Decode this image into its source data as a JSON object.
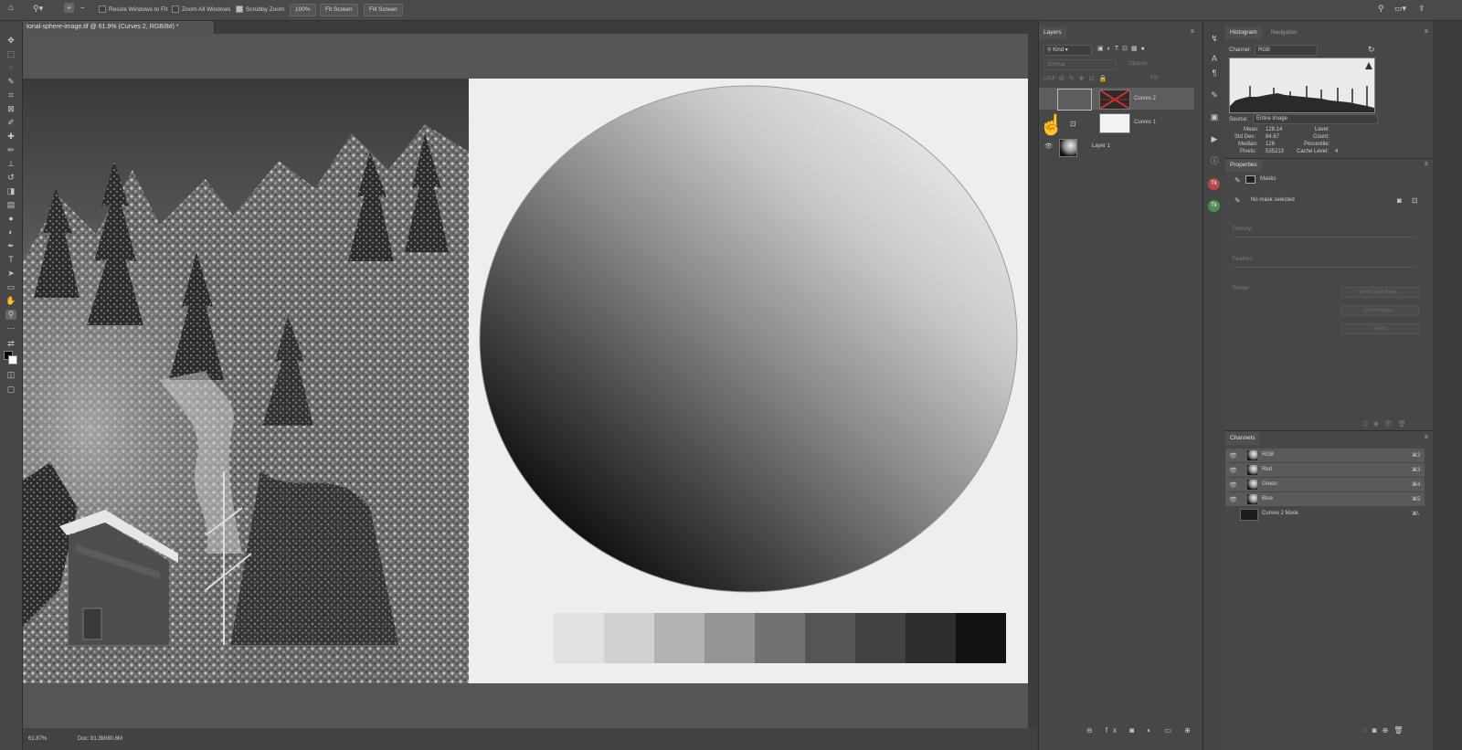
{
  "options_bar": {
    "resize_windows": "Resize Windows to Fit",
    "zoom_all": "Zoom All Windows",
    "scrubby_zoom": "Scrubby Zoom",
    "btn_100": "100%",
    "btn_fit": "Fit Screen",
    "btn_fill": "Fill Screen"
  },
  "document": {
    "tab_title": "tonal-sphere-image.tif @ 61.9% (Curves 2, RGB/8#) *",
    "zoom": "61.87%",
    "doc_info": "Doc: 81.3M/80.6M"
  },
  "swatches": {
    "tones": [
      "#e2e2e2",
      "#d1d1d1",
      "#b3b3b3",
      "#959595",
      "#727272",
      "#555555",
      "#424242",
      "#2d2d2d",
      "#111111"
    ]
  },
  "layers": {
    "tab": "Layers",
    "filter_kind": "Kind",
    "blend_mode": "Normal",
    "opacity_label": "Opacity:",
    "lock_label": "Lock:",
    "fill_label": "Fill:",
    "items": [
      {
        "name": "Curves 2"
      },
      {
        "name": "Curves 1"
      },
      {
        "name": "Layer 1"
      }
    ]
  },
  "histogram": {
    "tab": "Histogram",
    "tab2": "Navigation",
    "channel_label": "Channel:",
    "channel_value": "RGB",
    "source_label": "Source:",
    "source_value": "Entire Image",
    "mean_label": "Mean:",
    "mean_value": "128.14",
    "stddev_label": "Std Dev:",
    "stddev_value": "84.67",
    "median_label": "Median:",
    "median_value": "126",
    "pixels_label": "Pixels:",
    "pixels_value": "535213",
    "level_label": "Level:",
    "count_label": "Count:",
    "percentile_label": "Percentile:",
    "cache_label": "Cache Level:",
    "cache_value": "4"
  },
  "properties": {
    "tab": "Properties",
    "masks_label": "Masks",
    "no_mask": "No mask selected",
    "density_label": "Density:",
    "feather_label": "Feather:",
    "refine_label": "Refine:",
    "select_mask": "Select and Mask...",
    "color_range": "Color Range...",
    "invert": "Invert"
  },
  "channels": {
    "tab": "Channels",
    "items": [
      {
        "name": "RGB",
        "shortcut": "⌘2"
      },
      {
        "name": "Red",
        "shortcut": "⌘3"
      },
      {
        "name": "Green",
        "shortcut": "⌘4"
      },
      {
        "name": "Blue",
        "shortcut": "⌘5"
      },
      {
        "name": "Curves 2 Mask",
        "shortcut": "⌘\\"
      }
    ]
  }
}
